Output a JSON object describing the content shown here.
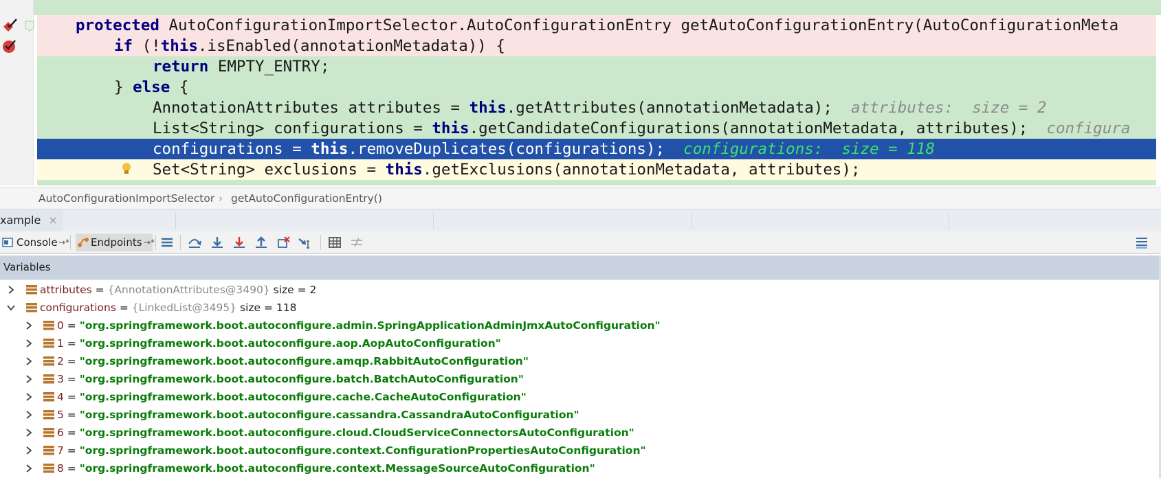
{
  "code": {
    "lines": [
      {
        "pre": "protected",
        "rest": " AutoConfigurationImportSelector.AutoConfigurationEntry getAutoConfigurationEntry(AutoConfigurationMeta"
      },
      {
        "pre": "if",
        "mid": " (!",
        "kw2": "this",
        "rest": ".isEnabled(annotationMetadata)) {"
      },
      {
        "pre": "return",
        "rest": " EMPTY_ENTRY;"
      },
      {
        "lead": "} ",
        "pre": "else",
        "rest": " {"
      },
      {
        "lead": "AnnotationAttributes attributes = ",
        "pre": "this",
        "rest": ".getAttributes(annotationMetadata);",
        "hint": "attributes:  size = 2"
      },
      {
        "lead": "List<String> configurations = ",
        "pre": "this",
        "rest": ".getCandidateConfigurations(annotationMetadata, attributes);",
        "hint": "configura"
      },
      {
        "lead": "configurations = ",
        "pre": "this",
        "rest": ".removeDuplicates(configurations);",
        "hint": "configurations:  size = 118"
      },
      {
        "lead": "Set<String> exclusions = ",
        "pre": "this",
        "rest": ".getExclusions(annotationMetadata, attributes);"
      }
    ]
  },
  "breadcrumb": {
    "class_name": "AutoConfigurationImportSelector",
    "separator": "›",
    "method_name": "getAutoConfigurationEntry()"
  },
  "debug_tab": {
    "label": "xample",
    "close": "×"
  },
  "toolbar": {
    "console_label": "Console",
    "console_pin": "→*",
    "endpoints_label": "Endpoints",
    "endpoints_pin": "→*"
  },
  "variables": {
    "header": "Variables",
    "top": [
      {
        "name": "attributes",
        "eq": " = ",
        "type": "{AnnotationAttributes@3490}",
        "size": " size = 2",
        "expanded": false
      },
      {
        "name": "configurations",
        "eq": " = ",
        "type": "{LinkedList@3495}",
        "size": " size = 118",
        "expanded": true
      }
    ],
    "items": [
      {
        "index": "0",
        "eq": " = ",
        "value": "\"org.springframework.boot.autoconfigure.admin.SpringApplicationAdminJmxAutoConfiguration\""
      },
      {
        "index": "1",
        "eq": " = ",
        "value": "\"org.springframework.boot.autoconfigure.aop.AopAutoConfiguration\""
      },
      {
        "index": "2",
        "eq": " = ",
        "value": "\"org.springframework.boot.autoconfigure.amqp.RabbitAutoConfiguration\""
      },
      {
        "index": "3",
        "eq": " = ",
        "value": "\"org.springframework.boot.autoconfigure.batch.BatchAutoConfiguration\""
      },
      {
        "index": "4",
        "eq": " = ",
        "value": "\"org.springframework.boot.autoconfigure.cache.CacheAutoConfiguration\""
      },
      {
        "index": "5",
        "eq": " = ",
        "value": "\"org.springframework.boot.autoconfigure.cassandra.CassandraAutoConfiguration\""
      },
      {
        "index": "6",
        "eq": " = ",
        "value": "\"org.springframework.boot.autoconfigure.cloud.CloudServiceConnectorsAutoConfiguration\""
      },
      {
        "index": "7",
        "eq": " = ",
        "value": "\"org.springframework.boot.autoconfigure.context.ConfigurationPropertiesAutoConfiguration\""
      },
      {
        "index": "8",
        "eq": " = ",
        "value": "\"org.springframework.boot.autoconfigure.context.MessageSourceAutoConfiguration\""
      }
    ]
  },
  "colors": {
    "executing_line": "#2151a8",
    "breakpoint_line": "#fae3e3",
    "code_background": "#cce8cc",
    "string_value": "#0a7d0a"
  }
}
